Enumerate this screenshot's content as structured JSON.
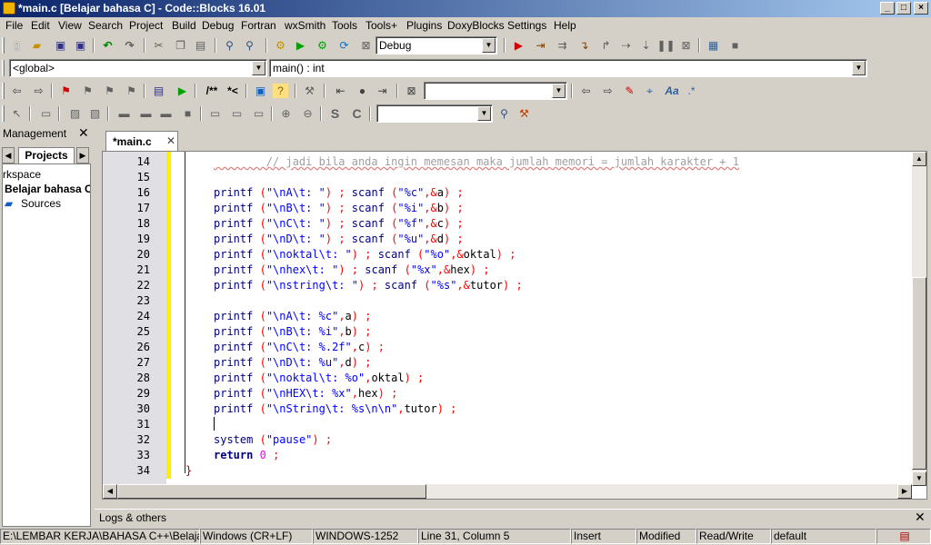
{
  "window": {
    "title": "*main.c [Belajar bahasa C] - Code::Blocks 16.01",
    "controls": [
      "_",
      "□",
      "×"
    ]
  },
  "menu": [
    "File",
    "Edit",
    "View",
    "Search",
    "Project",
    "Build",
    "Debug",
    "Fortran",
    "wxSmith",
    "Tools",
    "Tools+",
    "Plugins",
    "DoxyBlocks",
    "Settings",
    "Help"
  ],
  "toolbar": {
    "build_target": "Debug",
    "scope": "<global>",
    "function": "main() : int",
    "doxy_comment_1": "/**",
    "doxy_comment_2": "*<"
  },
  "management": {
    "title": "Management",
    "tab": "Projects",
    "tree": [
      "rkspace",
      "Belajar bahasa C",
      "Sources"
    ]
  },
  "editor": {
    "tab_label": "*main.c",
    "lines": [
      {
        "n": "14",
        "text": "        // jadi bila anda ingin memesan maka jumlah memori = jumlah karakter + 1",
        "comment": true
      },
      {
        "n": "15",
        "text": ""
      },
      {
        "n": "16",
        "text": "printf (\"\\nA\\t: \") ; scanf (\"%c\",&a) ;"
      },
      {
        "n": "17",
        "text": "printf (\"\\nB\\t: \") ; scanf (\"%i\",&b) ;"
      },
      {
        "n": "18",
        "text": "printf (\"\\nC\\t: \") ; scanf (\"%f\",&c) ;"
      },
      {
        "n": "19",
        "text": "printf (\"\\nD\\t: \") ; scanf (\"%u\",&d) ;"
      },
      {
        "n": "20",
        "text": "printf (\"\\noktal\\t: \") ; scanf (\"%o\",&oktal) ;"
      },
      {
        "n": "21",
        "text": "printf (\"\\nhex\\t: \") ; scanf (\"%x\",&hex) ;"
      },
      {
        "n": "22",
        "text": "printf (\"\\nstring\\t: \") ; scanf (\"%s\",&tutor) ;"
      },
      {
        "n": "23",
        "text": ""
      },
      {
        "n": "24",
        "text": "printf (\"\\nA\\t: %c\",a) ;"
      },
      {
        "n": "25",
        "text": "printf (\"\\nB\\t: %i\",b) ;"
      },
      {
        "n": "26",
        "text": "printf (\"\\nC\\t: %.2f\",c) ;"
      },
      {
        "n": "27",
        "text": "printf (\"\\nD\\t: %u\",d) ;"
      },
      {
        "n": "28",
        "text": "printf (\"\\noktal\\t: %o\",oktal) ;"
      },
      {
        "n": "29",
        "text": "printf (\"\\nHEX\\t: %x\",hex) ;"
      },
      {
        "n": "30",
        "text": "printf (\"\\nString\\t: %s\\n\\n\",tutor) ;"
      },
      {
        "n": "31",
        "text": ""
      },
      {
        "n": "32",
        "text": "system (\"pause\") ;"
      },
      {
        "n": "33",
        "text": "return 0 ;"
      },
      {
        "n": "34",
        "text": "}",
        "brace": true
      }
    ]
  },
  "logs": {
    "label": "Logs & others"
  },
  "status": {
    "path": "E:\\LEMBAR KERJA\\BAHASA C++\\Belajar bahasa",
    "eol": "Windows (CR+LF)",
    "encoding": "WINDOWS-1252",
    "position": "Line 31, Column 5",
    "mode": "Insert",
    "modified": "Modified",
    "access": "Read/Write",
    "lang": "default"
  },
  "colors": {
    "keyword": "#000080",
    "string": "#0000ff",
    "number": "#f000f0",
    "operator": "#ff0000",
    "comment": "#a0a0a0"
  }
}
